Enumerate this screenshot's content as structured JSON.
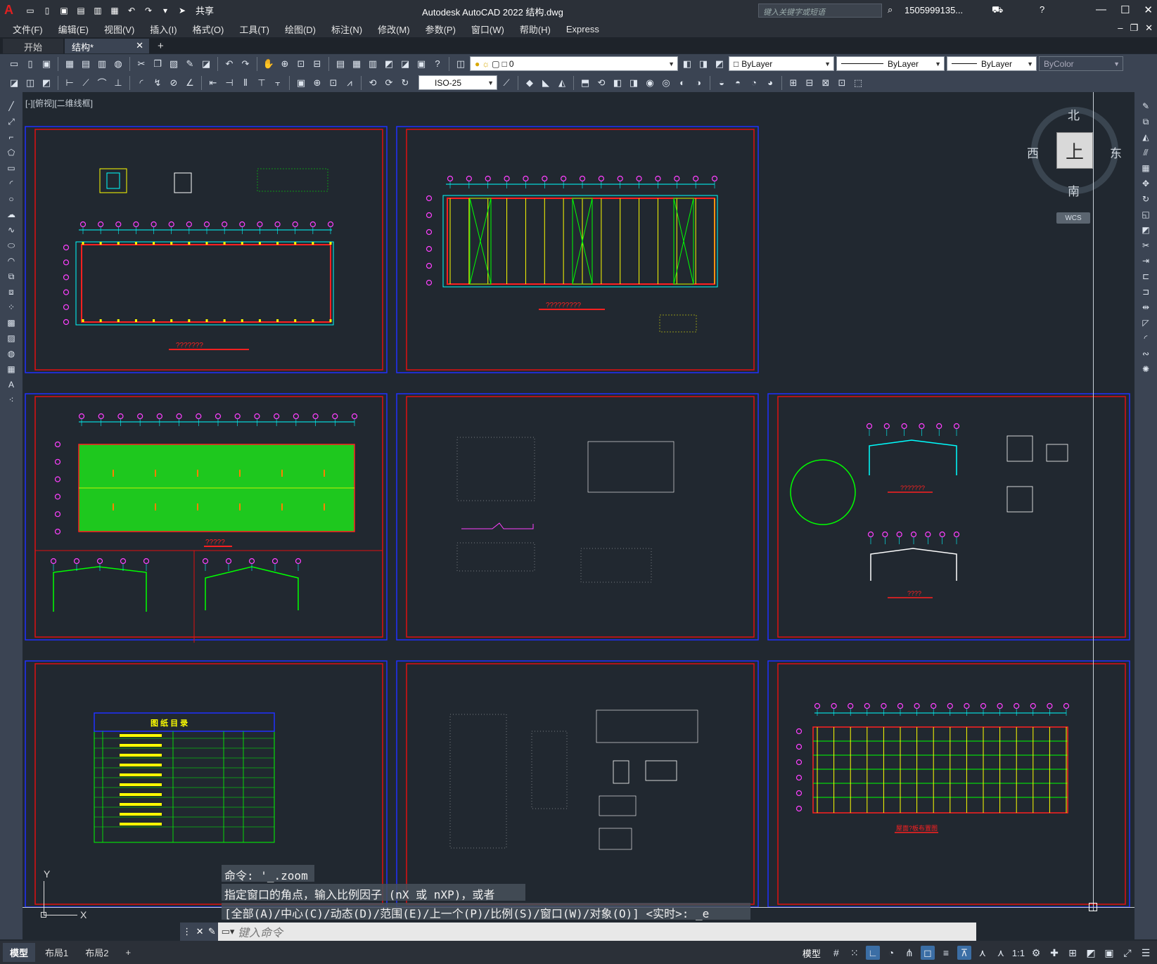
{
  "app": {
    "window_title": "Autodesk AutoCAD 2022    结构.dwg",
    "search_placeholder": "键入关键字或短语",
    "user": "1505999135...",
    "share": "共享"
  },
  "menu": [
    "文件(F)",
    "编辑(E)",
    "视图(V)",
    "插入(I)",
    "格式(O)",
    "工具(T)",
    "绘图(D)",
    "标注(N)",
    "修改(M)",
    "参数(P)",
    "窗口(W)",
    "帮助(H)",
    "Express"
  ],
  "file_tabs": {
    "start": "开始",
    "active": "结构*",
    "add": "+"
  },
  "toolbar": {
    "layer": "0",
    "color": "ByLayer",
    "linetype": "ByLayer",
    "lineweight": "ByLayer",
    "plotstyle": "ByColor",
    "dimstyle": "ISO-25"
  },
  "viewport_label": "[-][俯视][二维线框]",
  "viewcube": {
    "north": "北",
    "south": "南",
    "east": "东",
    "west": "西",
    "top": "上",
    "wcs": "WCS"
  },
  "drawing_titles": {
    "sheet1": "???????",
    "sheet2": "?????????",
    "sheet3": "?????",
    "sheet5": "???????",
    "sheet5b": "????",
    "sheet7": "图 纸 目 录",
    "sheet9": "屋面?板布置图"
  },
  "command_history": [
    "命令: '_.zoom",
    "指定窗口的角点，输入比例因子 (nX 或 nXP)，或者",
    "[全部(A)/中心(C)/动态(D)/范围(E)/上一个(P)/比例(S)/窗口(W)/对象(O)] <实时>: _e"
  ],
  "command_placeholder": "键入命令",
  "layout_tabs": [
    "模型",
    "布局1",
    "布局2"
  ],
  "status": {
    "model": "模型",
    "scale": "1:1"
  },
  "ucs": {
    "x": "X",
    "y": "Y"
  }
}
